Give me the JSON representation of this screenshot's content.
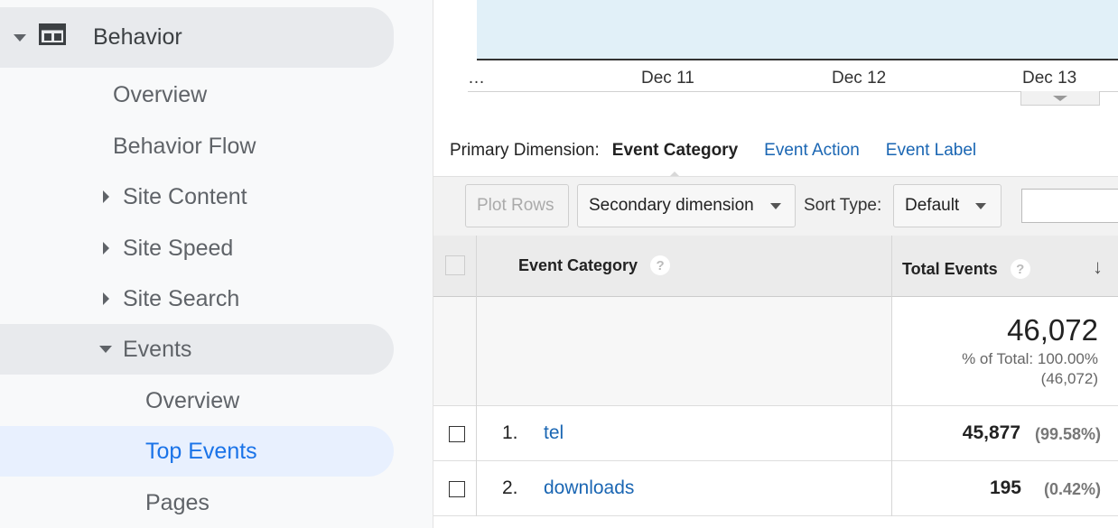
{
  "sidebar": {
    "section_title": "Behavior",
    "items": [
      {
        "label": "Overview"
      },
      {
        "label": "Behavior Flow"
      },
      {
        "label": "Site Content"
      },
      {
        "label": "Site Speed"
      },
      {
        "label": "Site Search"
      },
      {
        "label": "Events"
      },
      {
        "label": "Overview"
      },
      {
        "label": "Top Events"
      },
      {
        "label": "Pages"
      }
    ]
  },
  "chart": {
    "x_ticks": [
      "…",
      "Dec 11",
      "Dec 12",
      "Dec 13"
    ]
  },
  "dimension": {
    "label": "Primary Dimension:",
    "active": "Event Category",
    "links": [
      "Event Action",
      "Event Label"
    ]
  },
  "toolbar": {
    "plot_rows": "Plot Rows",
    "secondary_dimension": "Secondary dimension",
    "sort_type_label": "Sort Type:",
    "sort_type_value": "Default",
    "search_value": ""
  },
  "table": {
    "headers": {
      "category": "Event Category",
      "total_events": "Total Events",
      "help": "?"
    },
    "totals": {
      "value": "46,072",
      "pct_line": "% of Total: 100.00%",
      "abs_line": "(46,072)"
    },
    "rows": [
      {
        "num": "1.",
        "category": "tel",
        "total": "45,877",
        "pct": "(99.58%)"
      },
      {
        "num": "2.",
        "category": "downloads",
        "total": "195",
        "pct": "(0.42%)"
      }
    ]
  },
  "colors": {
    "link": "#1a66b3",
    "selected": "#1a73e8",
    "chart_fill": "#e1f0f8"
  }
}
